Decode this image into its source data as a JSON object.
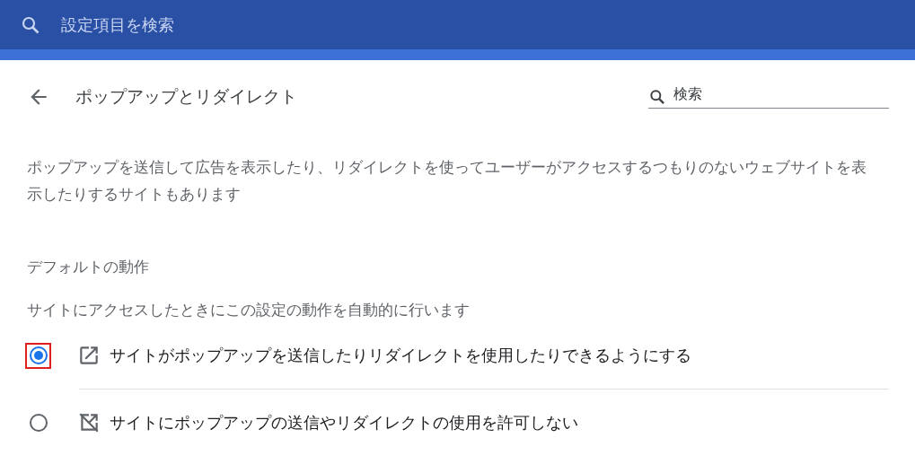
{
  "search_bar": {
    "placeholder": "設定項目を検索"
  },
  "header": {
    "title": "ポップアップとリダイレクト",
    "search": {
      "placeholder": "検索"
    }
  },
  "description": "ポップアップを送信して広告を表示したり、リダイレクトを使ってユーザーがアクセスするつもりのないウェブサイトを表示したりするサイトもあります",
  "section_title": "デフォルトの動作",
  "section_subtitle": "サイトにアクセスしたときにこの設定の動作を自動的に行います",
  "options": [
    {
      "label": "サイトがポップアップを送信したりリダイレクトを使用したりできるようにする",
      "selected": true,
      "kind": "allow",
      "highlighted": true
    },
    {
      "label": "サイトにポップアップの送信やリダイレクトの使用を許可しない",
      "selected": false,
      "kind": "block",
      "highlighted": false
    }
  ]
}
